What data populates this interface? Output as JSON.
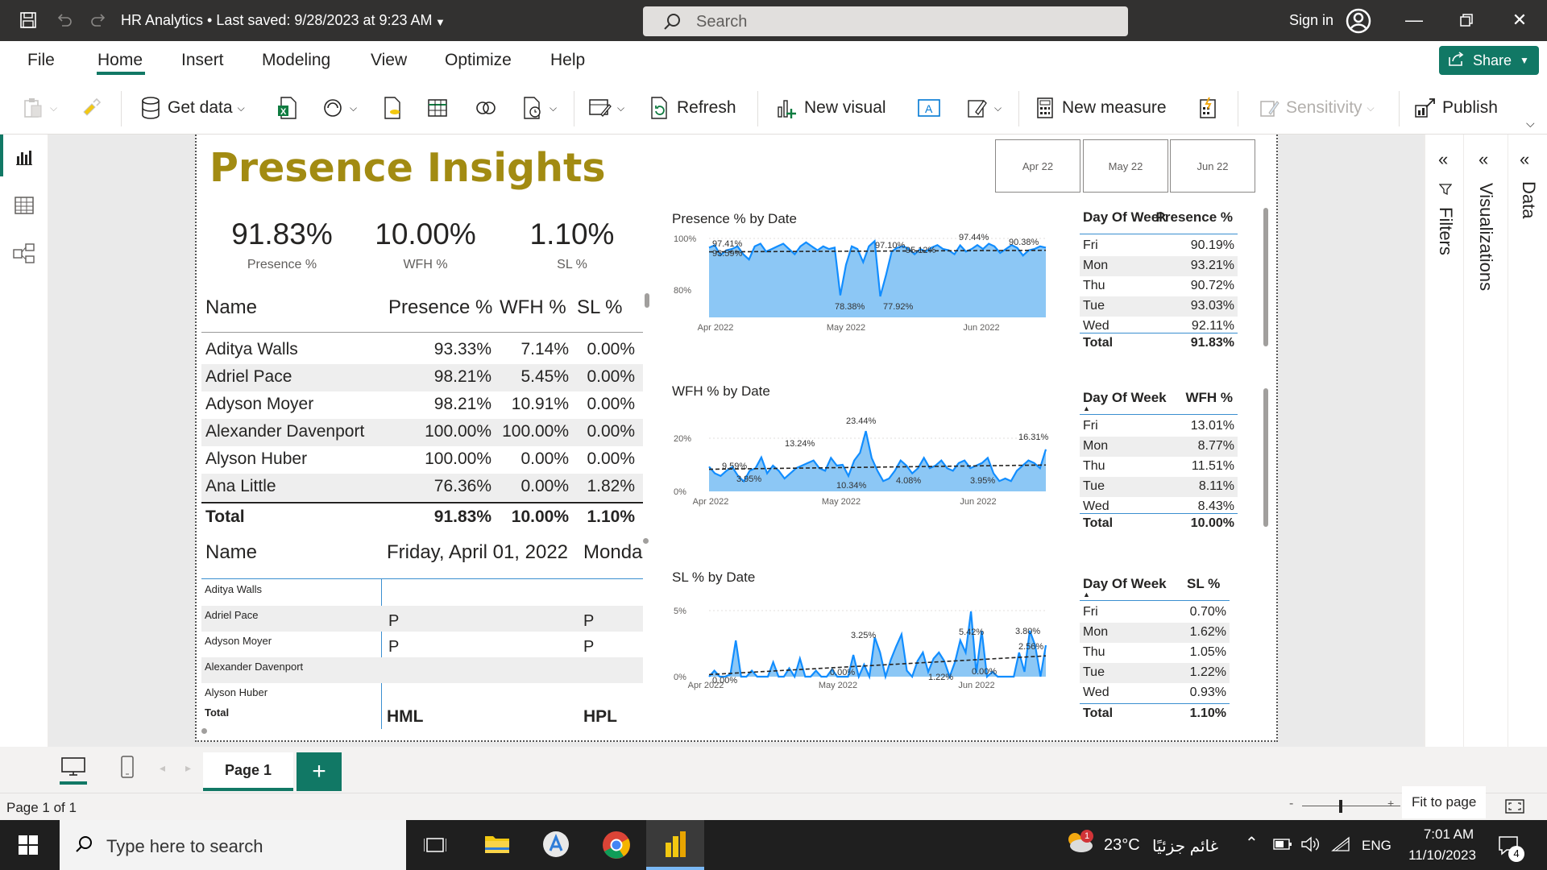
{
  "titlebar": {
    "title": "HR Analytics • Last saved: 9/28/2023 at 9:23 AM",
    "search_placeholder": "Search",
    "signin": "Sign in"
  },
  "menu": {
    "items": [
      "File",
      "Home",
      "Insert",
      "Modeling",
      "View",
      "Optimize",
      "Help"
    ],
    "share": "Share"
  },
  "ribbon": {
    "get_data": "Get data",
    "refresh": "Refresh",
    "new_visual": "New visual",
    "new_measure": "New measure",
    "sensitivity": "Sensitivity",
    "publish": "Publish"
  },
  "panes": {
    "filters": "Filters",
    "visualizations": "Visualizations",
    "data": "Data"
  },
  "report": {
    "title": "Presence Insights",
    "slicer": [
      "Apr 22",
      "May 22",
      "Jun 22"
    ],
    "kpis": [
      {
        "value": "91.83%",
        "label": "Presence %"
      },
      {
        "value": "10.00%",
        "label": "WFH %"
      },
      {
        "value": "1.10%",
        "label": "SL %"
      }
    ],
    "table": {
      "headers": [
        "Name",
        "Presence %",
        "WFH %",
        "SL %"
      ],
      "rows": [
        [
          "Aditya Walls",
          "93.33%",
          "7.14%",
          "0.00%"
        ],
        [
          "Adriel Pace",
          "98.21%",
          "5.45%",
          "0.00%"
        ],
        [
          "Adyson Moyer",
          "98.21%",
          "10.91%",
          "0.00%"
        ],
        [
          "Alexander Davenport",
          "100.00%",
          "100.00%",
          "0.00%"
        ],
        [
          "Alyson Huber",
          "100.00%",
          "0.00%",
          "0.00%"
        ],
        [
          "Ana Little",
          "76.36%",
          "0.00%",
          "1.82%"
        ]
      ],
      "total": [
        "Total",
        "91.83%",
        "10.00%",
        "1.10%"
      ]
    },
    "matrix": {
      "header_name": "Name",
      "header_date1": "Friday, April 01, 2022",
      "header_date2": "Monda",
      "rows": [
        {
          "name": "Aditya Walls",
          "d1": "",
          "d2": ""
        },
        {
          "name": "Adriel Pace",
          "d1": "P",
          "d2": "P"
        },
        {
          "name": "Adyson Moyer",
          "d1": "P",
          "d2": "P"
        },
        {
          "name": "Alexander Davenport",
          "d1": "",
          "d2": ""
        },
        {
          "name": "Alyson Huber",
          "d1": "",
          "d2": ""
        }
      ],
      "total_label": "Total",
      "total_d1": "HML",
      "total_d2": "HPL"
    },
    "dow_presence": {
      "headers": [
        "Day Of Week",
        "Presence %"
      ],
      "rows": [
        [
          "Fri",
          "90.19%"
        ],
        [
          "Mon",
          "93.21%"
        ],
        [
          "Thu",
          "90.72%"
        ],
        [
          "Tue",
          "93.03%"
        ],
        [
          "Wed",
          "92.11%"
        ]
      ],
      "total": [
        "Total",
        "91.83%"
      ]
    },
    "dow_wfh": {
      "headers": [
        "Day Of Week",
        "WFH %"
      ],
      "rows": [
        [
          "Fri",
          "13.01%"
        ],
        [
          "Mon",
          "8.77%"
        ],
        [
          "Thu",
          "11.51%"
        ],
        [
          "Tue",
          "8.11%"
        ],
        [
          "Wed",
          "8.43%"
        ]
      ],
      "total": [
        "Total",
        "10.00%"
      ]
    },
    "dow_sl": {
      "headers": [
        "Day Of Week",
        "SL %"
      ],
      "rows": [
        [
          "Fri",
          "0.70%"
        ],
        [
          "Mon",
          "1.62%"
        ],
        [
          "Thu",
          "1.05%"
        ],
        [
          "Tue",
          "1.22%"
        ],
        [
          "Wed",
          "0.93%"
        ]
      ],
      "total": [
        "Total",
        "1.10%"
      ]
    }
  },
  "chart_data": [
    {
      "type": "area",
      "title": "Presence % by Date",
      "x_ticks": [
        "Apr 2022",
        "May 2022",
        "Jun 2022"
      ],
      "y_ticks": [
        "100%",
        "80%"
      ],
      "ylim": [
        70,
        100
      ],
      "values": [
        96.5,
        97.4,
        93.6,
        95.5,
        96,
        97,
        94,
        92,
        97,
        98,
        95,
        96,
        97,
        98,
        96,
        94,
        97,
        98.5,
        97,
        95.5,
        97,
        96,
        96.5,
        78.4,
        90,
        97,
        96,
        91,
        97,
        99,
        78,
        86,
        95,
        96.5,
        97.1,
        96,
        94,
        96,
        95.1,
        96.5,
        97.5,
        96,
        95.5,
        94,
        97.4,
        95,
        96,
        97.5,
        96,
        98,
        97,
        94.5,
        96,
        97.5,
        96.4,
        93.5,
        95.5,
        96,
        97,
        96.5
      ],
      "labels": [
        "97.41%",
        "93.59%",
        "78.38%",
        "77.92%",
        "97.10%",
        "95.12%",
        "97.44%",
        "90.38%"
      ],
      "trendline": true
    },
    {
      "type": "area",
      "title": "WFH % by Date",
      "x_ticks": [
        "Apr 2022",
        "May 2022",
        "Jun 2022"
      ],
      "y_ticks": [
        "20%",
        "0%"
      ],
      "ylim": [
        0,
        25
      ],
      "values": [
        9.6,
        7,
        6,
        8,
        9.5,
        6,
        3.9,
        8,
        9,
        13.2,
        7,
        10,
        8,
        5,
        7,
        9,
        10,
        11,
        12,
        9,
        8,
        13,
        10,
        10.3,
        6,
        12,
        15,
        23.4,
        13,
        8,
        4,
        5,
        8,
        12,
        10,
        7,
        9,
        13,
        9,
        10,
        12,
        9,
        8,
        11,
        12,
        9,
        10,
        11,
        13,
        7,
        4,
        5,
        4,
        8,
        10,
        12,
        11,
        9,
        16.3
      ],
      "labels": [
        "9.59%",
        "13.24%",
        "3.95%",
        "23.44%",
        "10.34%",
        "4.08%",
        "3.95%",
        "16.31%"
      ],
      "trendline": true
    },
    {
      "type": "area",
      "title": "SL % by Date",
      "x_ticks": [
        "Apr 2022",
        "May 2022",
        "Jun 2022"
      ],
      "y_ticks": [
        "5%",
        "0%"
      ],
      "ylim": [
        0,
        6
      ],
      "values": [
        0,
        0.5,
        0,
        0,
        0.2,
        3,
        0,
        0,
        0.5,
        0,
        0,
        0,
        1.2,
        0,
        0,
        0.7,
        0,
        1.5,
        0,
        0,
        0.5,
        0,
        0,
        0.6,
        0,
        0,
        0,
        1.8,
        0,
        1,
        0,
        3.25,
        2,
        0,
        1.4,
        2.5,
        3.5,
        0.5,
        0,
        1.3,
        2,
        0.4,
        1.5,
        2,
        1.3,
        0,
        1.2,
        3,
        2,
        5.4,
        0.3,
        3.8,
        0,
        0.4,
        0,
        0,
        0,
        0,
        2,
        0.4,
        3.8,
        2.6,
        0,
        2.6
      ],
      "labels": [
        "0.00%",
        "3.25%",
        "0.00%",
        "1.22%",
        "5.42%",
        "3.80%",
        "2.56%",
        "0.00%"
      ],
      "trendline": true
    }
  ],
  "statusbar": {
    "page_tab": "Page 1",
    "page_count": "Page 1 of 1",
    "fit_to_page": "Fit to page"
  },
  "taskbar": {
    "search_placeholder": "Type here to search",
    "weather_temp": "23°C",
    "weather_desc": "غائم جزئيًا",
    "language": "ENG",
    "time": "7:01 AM",
    "date": "11/10/2023",
    "notifications": "4",
    "weather_badge": "1"
  }
}
